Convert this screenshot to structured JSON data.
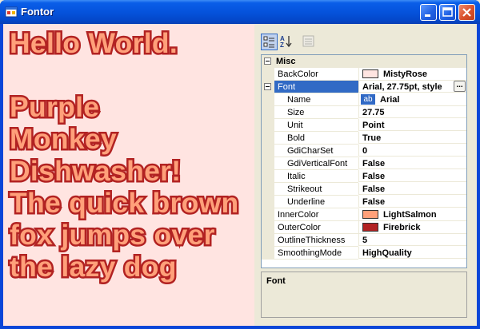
{
  "window": {
    "title": "Fontor",
    "controls": [
      "minimize",
      "maximize",
      "close"
    ]
  },
  "canvas": {
    "text": "Hello World.\n\nPurple\nMonkey\nDishwasher!\nThe quick brown\nfox jumps over\nthe lazy dog",
    "fill_color": "#FFA07A",
    "outline_color": "#B22222",
    "background": "#FFE4E1"
  },
  "toolbar": {
    "buttons": [
      {
        "icon": "categorized-icon",
        "state": "pressed"
      },
      {
        "icon": "alphabetical-icon",
        "state": "normal"
      },
      {
        "icon": "property-pages-icon",
        "state": "disabled"
      }
    ]
  },
  "property_grid": {
    "category": "Misc",
    "rows": [
      {
        "name": "BackColor",
        "value": "MistyRose",
        "swatch": "#FFE4E1"
      },
      {
        "name": "Font",
        "value": "Arial, 27.75pt, style",
        "selected": true,
        "expandable": true
      },
      {
        "name": "Name",
        "value": "Arial",
        "sub": true
      },
      {
        "name": "Size",
        "value": "27.75",
        "sub": true
      },
      {
        "name": "Unit",
        "value": "Point",
        "sub": true
      },
      {
        "name": "Bold",
        "value": "True",
        "sub": true
      },
      {
        "name": "GdiCharSet",
        "value": "0",
        "sub": true
      },
      {
        "name": "GdiVerticalFont",
        "value": "False",
        "sub": true
      },
      {
        "name": "Italic",
        "value": "False",
        "sub": true
      },
      {
        "name": "Strikeout",
        "value": "False",
        "sub": true
      },
      {
        "name": "Underline",
        "value": "False",
        "sub": true
      },
      {
        "name": "InnerColor",
        "value": "LightSalmon",
        "swatch": "#FFA07A"
      },
      {
        "name": "OuterColor",
        "value": "Firebrick",
        "swatch": "#B22222"
      },
      {
        "name": "OutlineThickness",
        "value": "5"
      },
      {
        "name": "SmoothingMode",
        "value": "HighQuality"
      }
    ],
    "font_name_preview": "ab",
    "ellipsis_label": "...",
    "description_title": "Font"
  }
}
